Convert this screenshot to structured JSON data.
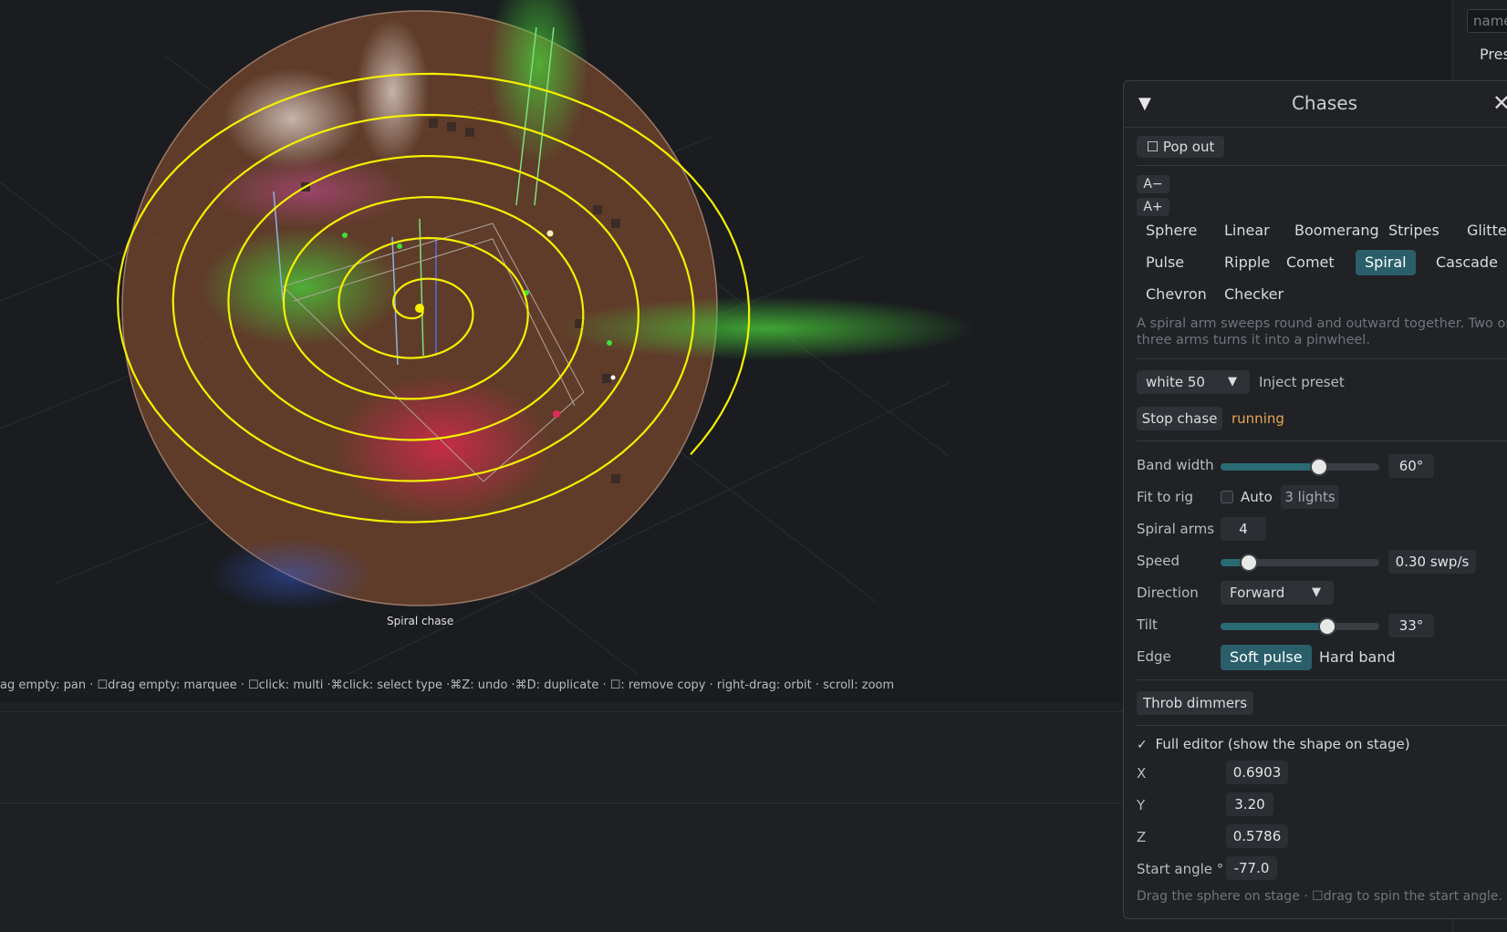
{
  "viewport": {
    "hint": "ag empty: pan · ☐drag empty: marquee · ☐click: multi ·⌘click: select type ·⌘Z: undo ·⌘D: duplicate · ☐: remove copy · right-drag: orbit · scroll: zoom",
    "sphere_label": "Spiral chase",
    "colors": {
      "sphere": "#7a4a2e",
      "spiral": "#f5f000"
    }
  },
  "right_strip": {
    "input_placeholder": "name",
    "label": "Pres"
  },
  "panel": {
    "title": "Chases",
    "pop_out": "☐ Pop out",
    "font_minus": "A−",
    "font_plus": "A+",
    "patterns": [
      "Sphere",
      "Linear",
      "Boomerang",
      "Stripes",
      "Glitter",
      "Pulse",
      "Ripple",
      "Comet",
      "Spiral",
      "Cascade",
      "Chevron",
      "Checker"
    ],
    "active_pattern": "Spiral",
    "description": "A spiral arm sweeps round and outward together. Two or three arms turns it into a pinwheel.",
    "preset_select": "white 50",
    "inject_label": "Inject preset",
    "stop_button": "Stop chase",
    "status": "running",
    "status_color": "#e8a650",
    "params": {
      "band_width": {
        "label": "Band width",
        "value": "60°",
        "level": 0.62
      },
      "fit_to_rig": {
        "label": "Fit to rig",
        "auto": "Auto",
        "lights": "3 lights"
      },
      "spiral_arms": {
        "label": "Spiral arms",
        "value": "4"
      },
      "speed": {
        "label": "Speed",
        "value": "0.30 swp/s",
        "level": 0.18
      },
      "direction": {
        "label": "Direction",
        "value": "Forward"
      },
      "tilt": {
        "label": "Tilt",
        "value": "33°",
        "level": 0.67
      },
      "edge": {
        "label": "Edge",
        "soft": "Soft pulse",
        "hard": "Hard band"
      }
    },
    "throb_button": "Throb dimmers",
    "full_editor": "Full editor (show the shape on stage)",
    "coords": {
      "x_label": "X",
      "x": "0.6903",
      "y_label": "Y",
      "y": "3.20",
      "z_label": "Z",
      "z": "0.5786",
      "angle_label": "Start angle °",
      "angle": "-77.0"
    },
    "footer_hint": "Drag the sphere on stage · ☐drag to spin the start angle."
  }
}
